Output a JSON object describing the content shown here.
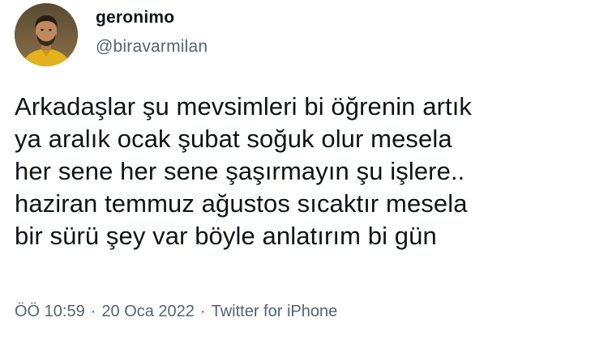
{
  "user": {
    "display_name": "geronimo",
    "handle": "@biravarmilan",
    "avatar_icon": "user-avatar-photo"
  },
  "tweet": {
    "lines": [
      "Arkadaşlar şu mevsimleri bi öğrenin artık",
      "ya aralık ocak şubat soğuk olur mesela",
      "her sene her sene şaşırmayın şu işlere..",
      "haziran temmuz ağustos sıcaktır mesela",
      "bir sürü şey var böyle anlatırım bi gün"
    ]
  },
  "meta": {
    "time": "ÖÖ 10:59",
    "separator": "·",
    "date": "20 Oca 2022",
    "source": "Twitter for iPhone"
  },
  "colors": {
    "text_primary": "#0f1419",
    "text_secondary": "#536471",
    "background": "#ffffff"
  }
}
